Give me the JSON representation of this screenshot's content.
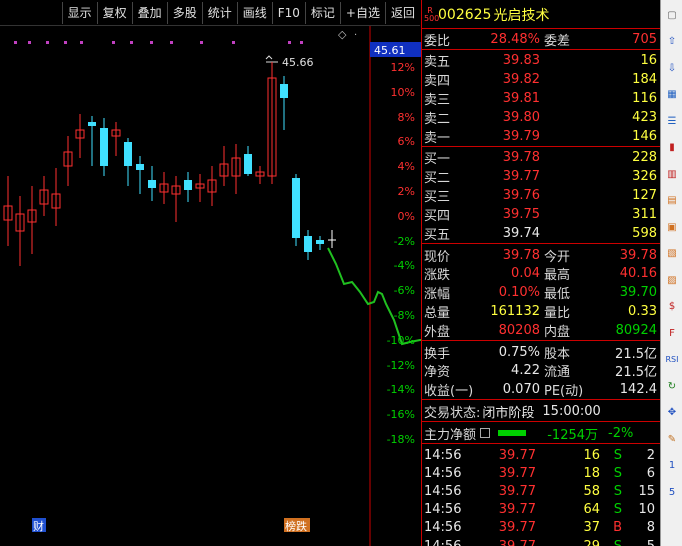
{
  "toolbar": {
    "items": [
      "显示",
      "复权",
      "叠加",
      "多股",
      "统计",
      "画线",
      "F10",
      "标记",
      "+自选",
      "返回"
    ]
  },
  "stock": {
    "market_badge_top": "R",
    "market_badge_bottom": "500",
    "code": "002625",
    "name": "光启技术"
  },
  "order_book": {
    "weibi_label": "委比",
    "weibi_value": "28.48%",
    "weicha_label": "委差",
    "weicha_value": "705",
    "asks": [
      {
        "label": "卖五",
        "price": "39.83",
        "vol": "16"
      },
      {
        "label": "卖四",
        "price": "39.82",
        "vol": "184"
      },
      {
        "label": "卖三",
        "price": "39.81",
        "vol": "116"
      },
      {
        "label": "卖二",
        "price": "39.80",
        "vol": "423"
      },
      {
        "label": "卖一",
        "price": "39.79",
        "vol": "146"
      }
    ],
    "bids": [
      {
        "label": "买一",
        "price": "39.78",
        "vol": "228"
      },
      {
        "label": "买二",
        "price": "39.77",
        "vol": "326"
      },
      {
        "label": "买三",
        "price": "39.76",
        "vol": "127"
      },
      {
        "label": "买四",
        "price": "39.75",
        "vol": "311"
      },
      {
        "label": "买五",
        "price": "39.74",
        "vol": "598"
      }
    ]
  },
  "quote": {
    "rows": [
      {
        "l1": "现价",
        "v1": "39.78",
        "c1": "red",
        "l2": "今开",
        "v2": "39.78",
        "c2": "red"
      },
      {
        "l1": "涨跌",
        "v1": "0.04",
        "c1": "red",
        "l2": "最高",
        "v2": "40.16",
        "c2": "red"
      },
      {
        "l1": "涨幅",
        "v1": "0.10%",
        "c1": "red",
        "l2": "最低",
        "v2": "39.70",
        "c2": "grn"
      },
      {
        "l1": "总量",
        "v1": "161132",
        "c1": "yel",
        "l2": "量比",
        "v2": "0.33",
        "c2": "yel"
      },
      {
        "l1": "外盘",
        "v1": "80208",
        "c1": "red",
        "l2": "内盘",
        "v2": "80924",
        "c2": "grn"
      }
    ],
    "stats": [
      {
        "l1": "换手",
        "v1": "0.75%",
        "l2": "股本",
        "v2": "21.5亿"
      },
      {
        "l1": "净资",
        "v1": "4.22",
        "l2": "流通",
        "v2": "21.5亿"
      },
      {
        "l1": "收益(一)",
        "v1": "0.070",
        "l2": "PE(动)",
        "v2": "142.4"
      }
    ]
  },
  "status": {
    "label": "交易状态:",
    "value": "闭市阶段",
    "time": "15:00:00"
  },
  "main_force": {
    "label": "主力净额",
    "amount": "-1254万",
    "pct": "-2%"
  },
  "ticks": [
    {
      "time": "14:56",
      "price": "39.77",
      "vol": "16",
      "side": "S",
      "n": "2"
    },
    {
      "time": "14:56",
      "price": "39.77",
      "vol": "18",
      "side": "S",
      "n": "6"
    },
    {
      "time": "14:56",
      "price": "39.77",
      "vol": "58",
      "side": "S",
      "n": "15"
    },
    {
      "time": "14:56",
      "price": "39.77",
      "vol": "64",
      "side": "S",
      "n": "10"
    },
    {
      "time": "14:56",
      "price": "39.77",
      "vol": "37",
      "side": "B",
      "n": "8"
    },
    {
      "time": "14:56",
      "price": "39.77",
      "vol": "29",
      "side": "S",
      "n": "5"
    }
  ],
  "chart_data": {
    "type": "candlestick",
    "current_price_tag": "45.61",
    "high_annotation": "45.66",
    "pct_axis": [
      "12%",
      "10%",
      "8%",
      "6%",
      "4%",
      "2%",
      "0%",
      "-2%",
      "-4%",
      "-6%",
      "-8%",
      "-10%",
      "-12%",
      "-14%",
      "-16%",
      "-18%"
    ],
    "bottom_markers": [
      "财",
      "榜跌"
    ],
    "up_color": "#ff3030",
    "down_color": "#40e0ff",
    "trend_line_color": "#20c020"
  },
  "sidebar_icons": [
    "page-icon",
    "up-arrow-icon",
    "down-arrow-icon",
    "grid-icon",
    "list-icon",
    "candle-icon",
    "bars-icon",
    "book-icon",
    "calendar-icon",
    "chart-icon",
    "line-icon",
    "dollar-icon",
    "f-icon",
    "rsi-icon",
    "refresh-icon",
    "crosshair-icon",
    "pen-icon",
    "1",
    "5"
  ]
}
